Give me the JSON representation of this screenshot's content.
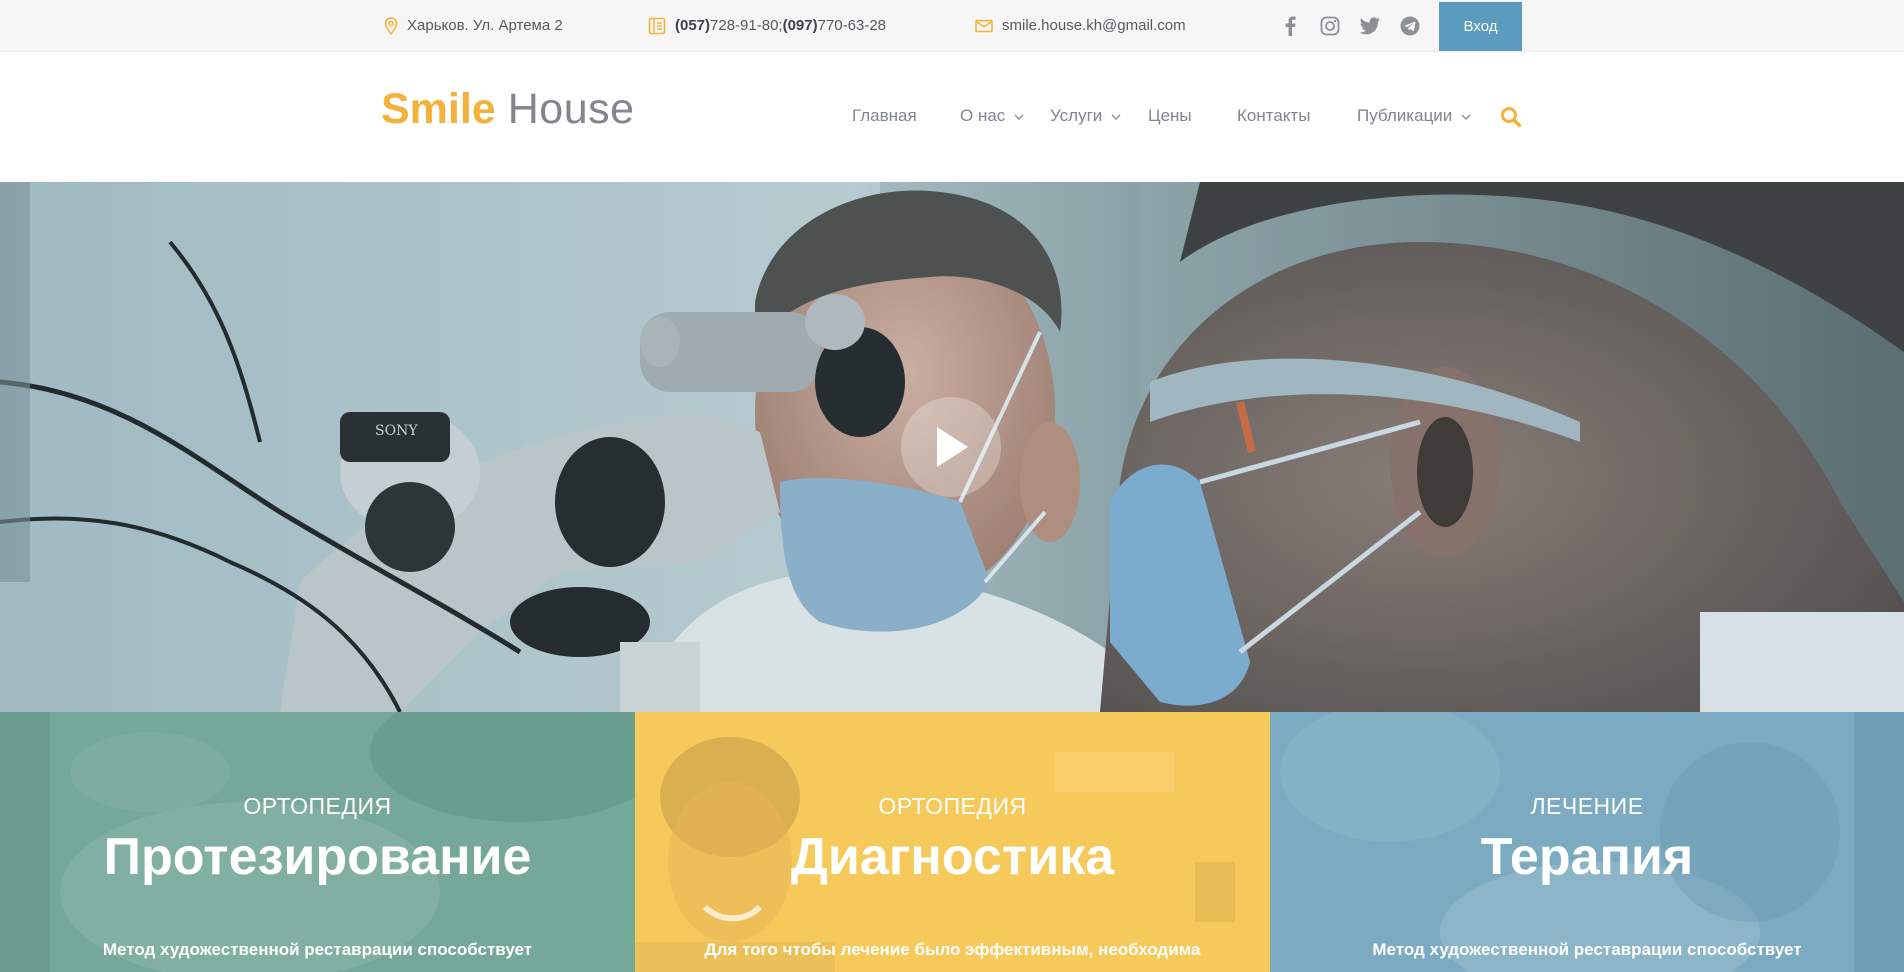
{
  "topbar": {
    "address": "Харьков. Ул. Артема 2",
    "phone_code_1": "(057)",
    "phone_num_1": " 728-91-80; ",
    "phone_code_2": "(097)",
    "phone_num_2": " 770-63-28",
    "email": "smile.house.kh@gmail.com",
    "socials": [
      "facebook-icon",
      "instagram-icon",
      "twitter-icon",
      "telegram-icon"
    ],
    "login_label": "Вход"
  },
  "header": {
    "logo_bold": "Smile",
    "logo_light": "House",
    "nav": [
      {
        "label": "Главная",
        "has_dropdown": false
      },
      {
        "label": "О нас",
        "has_dropdown": true
      },
      {
        "label": "Услуги",
        "has_dropdown": true
      },
      {
        "label": "Цены",
        "has_dropdown": false
      },
      {
        "label": "Контакты",
        "has_dropdown": false
      },
      {
        "label": "Публикации",
        "has_dropdown": true
      }
    ]
  },
  "hero": {
    "play_icon": "play-icon",
    "microscope_brand": "SONY"
  },
  "tiles": [
    {
      "category": "ОРТОПЕДИЯ",
      "title": "Протезирование",
      "description": "Метод художественной реставрации способствует",
      "color": "#76a89a"
    },
    {
      "category": "ОРТОПЕДИЯ",
      "title": "Диагностика",
      "description": "Для того чтобы лечение было эффективным, необходима",
      "color": "#f5c95a"
    },
    {
      "category": "ЛЕЧЕНИЕ",
      "title": "Терапия",
      "description": "Метод художественной реставрации способствует",
      "color": "#7cabc1"
    }
  ],
  "colors": {
    "accent": "#f4b13b",
    "login_button": "#5b9bbd",
    "nav_text": "#7f868c"
  }
}
